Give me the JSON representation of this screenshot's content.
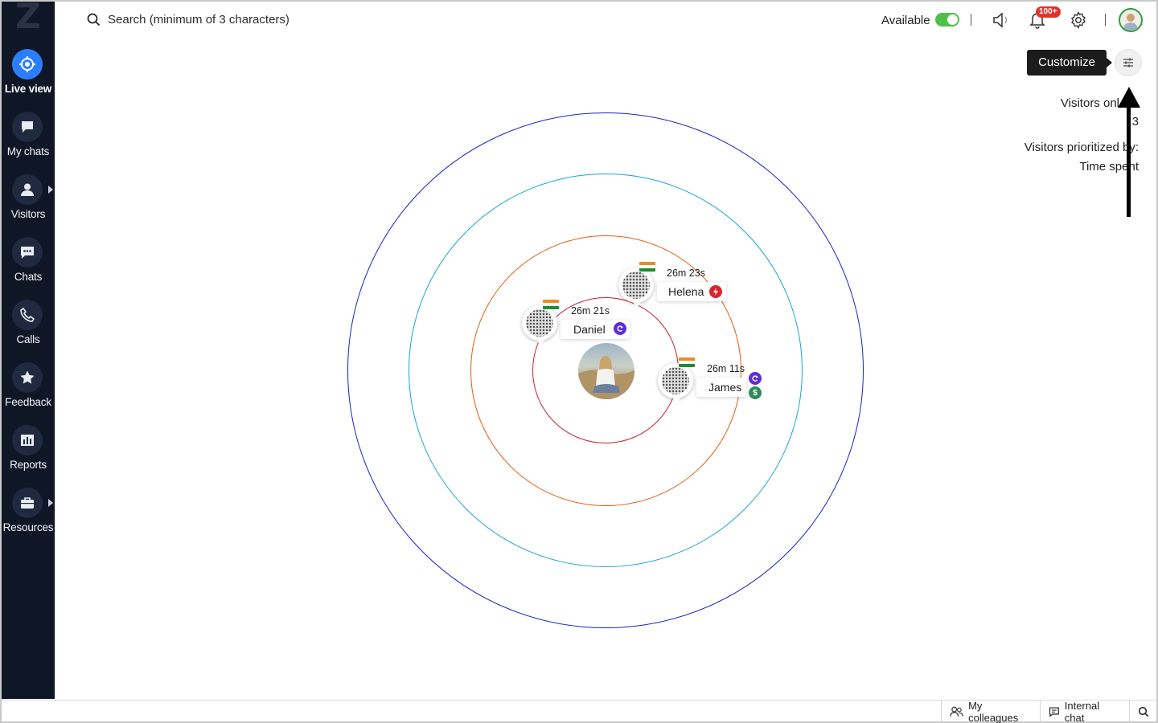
{
  "brand": {
    "logo_letter": "Z"
  },
  "sidebar": {
    "items": [
      {
        "label": "Live view",
        "icon": "live-view-icon",
        "active": true
      },
      {
        "label": "My chats",
        "icon": "chat-bubble-icon"
      },
      {
        "label": "Visitors",
        "icon": "person-icon",
        "has_submenu": true
      },
      {
        "label": "Chats",
        "icon": "chat-dots-icon"
      },
      {
        "label": "Calls",
        "icon": "phone-icon"
      },
      {
        "label": "Feedback",
        "icon": "star-icon"
      },
      {
        "label": "Reports",
        "icon": "bar-chart-icon"
      },
      {
        "label": "Resources",
        "icon": "briefcase-icon",
        "has_submenu": true
      }
    ]
  },
  "header": {
    "search": {
      "placeholder": "Search (minimum of 3 characters)"
    },
    "status": {
      "label": "Available",
      "on": true
    },
    "notifications": {
      "badge": "100+"
    }
  },
  "customize": {
    "tooltip": "Customize"
  },
  "info": {
    "visitors_online_label": "Visitors onl",
    "visitors_online_count": "3",
    "prioritized_label": "Visitors prioritized b",
    "prioritized_label_end": "y:",
    "prioritized_value": "Time spe",
    "prioritized_value_end": "nt"
  },
  "radar": {
    "ring_colors": [
      "#1a22c9",
      "#19a3d8",
      "#e25c12",
      "#cc1f32"
    ]
  },
  "visitors": [
    {
      "name": "Helena",
      "time": "26m 23s",
      "badges": [
        {
          "icon": "lightning-icon",
          "color": "#d9242b"
        }
      ]
    },
    {
      "name": "Daniel",
      "time": "26m 21s",
      "badges": [
        {
          "icon": "refresh-icon",
          "color": "#5b2fd6"
        }
      ]
    },
    {
      "name": "James",
      "time": "26m 11s",
      "badges": [
        {
          "icon": "refresh-icon",
          "color": "#5b2fd6"
        },
        {
          "icon": "dollar-icon",
          "color": "#2e8b57"
        }
      ]
    }
  ],
  "footer": {
    "colleagues_label": "My colleagues",
    "internal_chat_label": "Internal chat"
  }
}
